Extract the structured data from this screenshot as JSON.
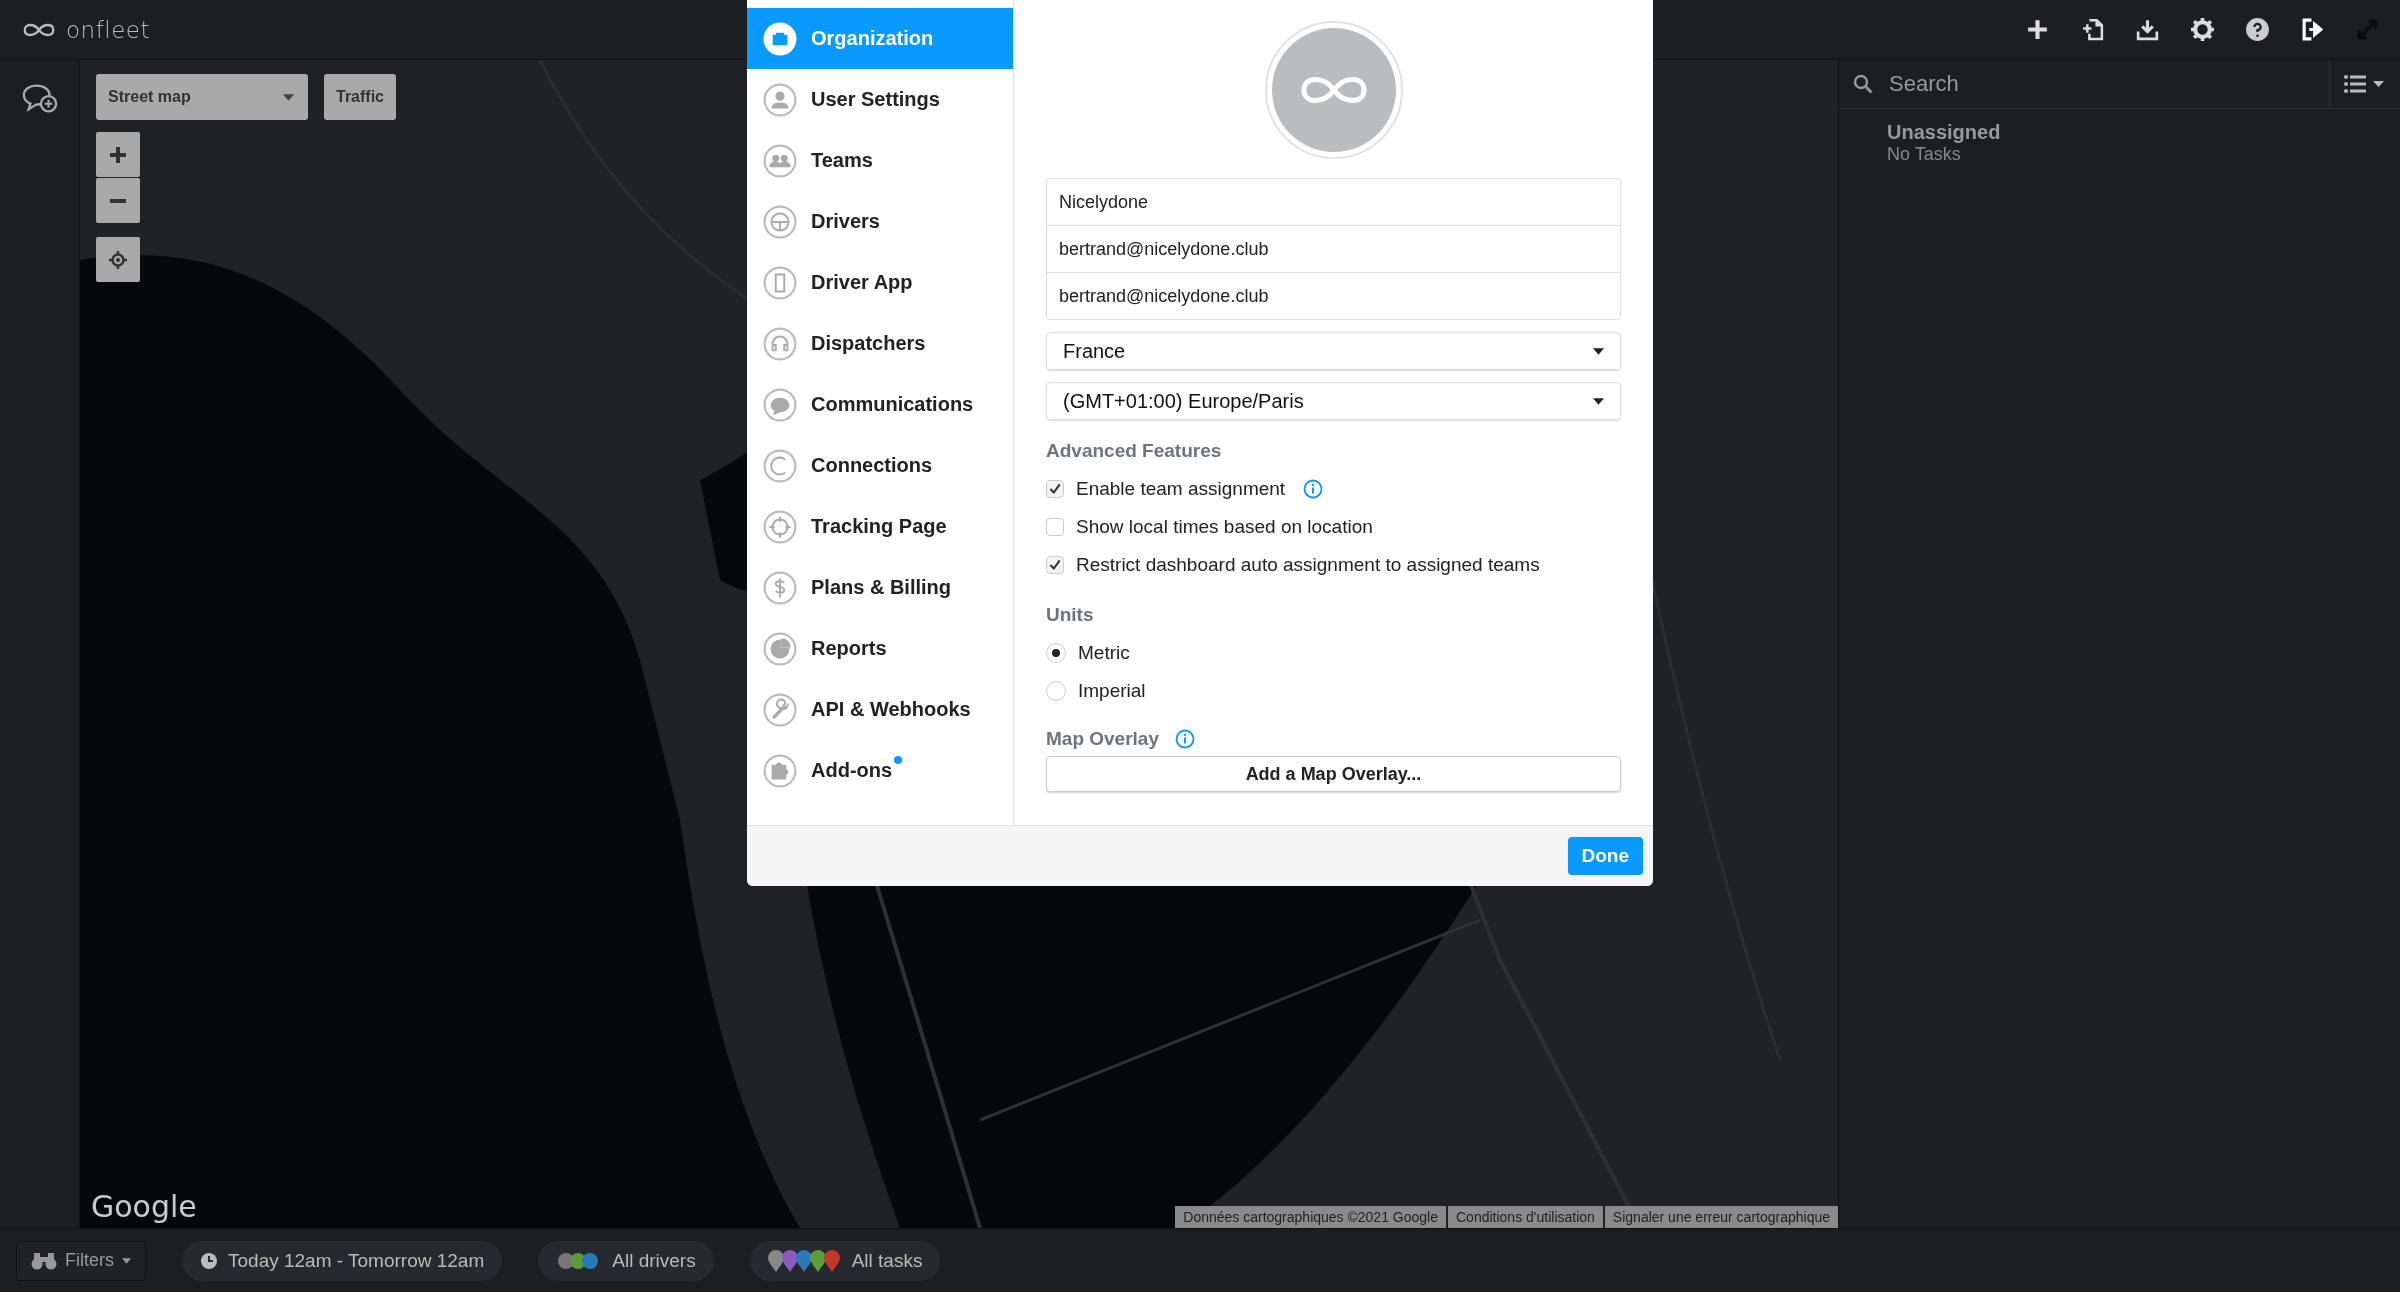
{
  "top_bar": {
    "logo": "onfleet"
  },
  "map": {
    "map_type": "Street map",
    "traffic_button": "Traffic",
    "logo": "Google",
    "footer_links": [
      "Données cartographiques ©2021 Google",
      "Conditions d'utilisation",
      "Signaler une erreur cartographique"
    ]
  },
  "right_panel": {
    "search": {
      "placeholder": "Search"
    },
    "groups": [
      {
        "title": "Unassigned",
        "subtitle": "No Tasks"
      }
    ]
  },
  "settings_dialog": {
    "nav": [
      {
        "label": "Organization",
        "selected": true,
        "badge": false
      },
      {
        "label": "User Settings",
        "selected": false,
        "badge": false
      },
      {
        "label": "Teams",
        "selected": false,
        "badge": false
      },
      {
        "label": "Drivers",
        "selected": false,
        "badge": false
      },
      {
        "label": "Driver App",
        "selected": false,
        "badge": false
      },
      {
        "label": "Dispatchers",
        "selected": false,
        "badge": false
      },
      {
        "label": "Communications",
        "selected": false,
        "badge": false
      },
      {
        "label": "Connections",
        "selected": false,
        "badge": false
      },
      {
        "label": "Tracking Page",
        "selected": false,
        "badge": false
      },
      {
        "label": "Plans & Billing",
        "selected": false,
        "badge": false
      },
      {
        "label": "Reports",
        "selected": false,
        "badge": false
      },
      {
        "label": "API & Webhooks",
        "selected": false,
        "badge": false
      },
      {
        "label": "Add-ons",
        "selected": false,
        "badge": true
      }
    ],
    "fields": [
      {
        "value": "Nicelydone"
      },
      {
        "value": "bertrand@nicelydone.club"
      },
      {
        "value": "bertrand@nicelydone.club"
      }
    ],
    "selects": [
      {
        "value": "France"
      },
      {
        "value": "(GMT+01:00) Europe/Paris"
      }
    ],
    "advanced_title": "Advanced Features",
    "options": [
      {
        "label": "Enable team assignment",
        "checked": true,
        "info": true
      },
      {
        "label": "Show local times based on location",
        "checked": false,
        "info": false
      },
      {
        "label": "Restrict dashboard auto assignment to assigned teams",
        "checked": true,
        "info": false
      }
    ],
    "units_title": "Units",
    "units": [
      {
        "label": "Metric",
        "selected": true
      },
      {
        "label": "Imperial",
        "selected": false
      }
    ],
    "overlay_title": "Map Overlay",
    "overlay_button": "Add a Map Overlay...",
    "done_button": "Done"
  },
  "bottom_bar": {
    "filters": "Filters",
    "time_range": "Today 12am - Tomorrow 12am",
    "drivers": "All drivers",
    "tasks": "All tasks"
  }
}
